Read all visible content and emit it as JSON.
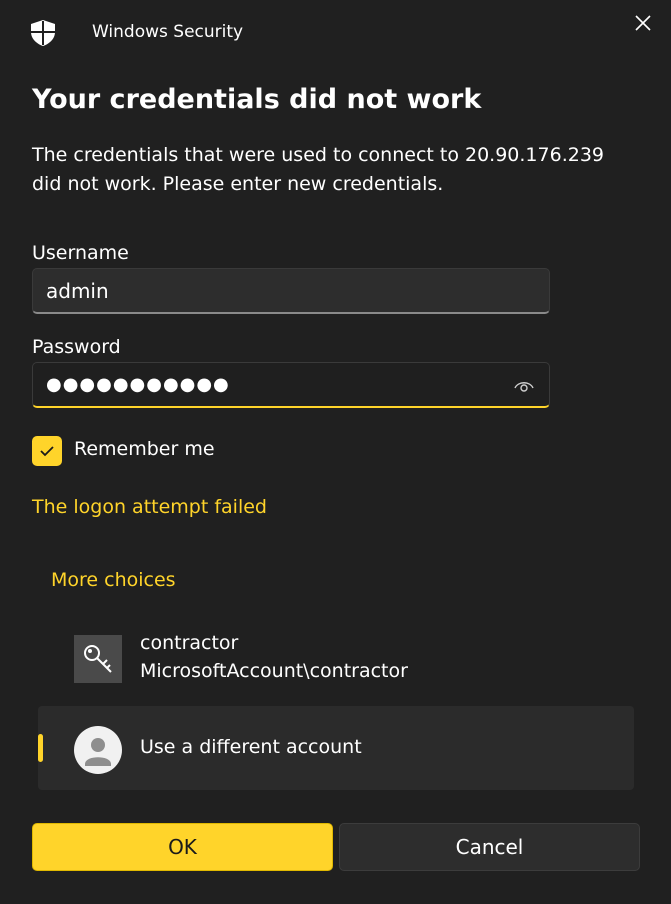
{
  "window": {
    "title": "Windows Security",
    "app_icon": "shield-icon",
    "close_icon": "close-icon"
  },
  "dialog": {
    "heading": "Your credentials did not work",
    "message": "The credentials that were used to connect to 20.90.176.239 did not work. Please enter new credentials."
  },
  "form": {
    "username_label": "Username",
    "username_value": "admin",
    "password_label": "Password",
    "password_masked": "●●●●●●●●●●●",
    "reveal_icon": "eye-icon",
    "remember_label": "Remember me",
    "remember_checked": true
  },
  "error": {
    "text": "The logon attempt failed"
  },
  "choices": {
    "header": "More choices",
    "accounts": [
      {
        "name": "contractor",
        "detail": "MicrosoftAccount\\contractor",
        "icon": "key-icon"
      },
      {
        "name": "Use a different account",
        "icon": "user-avatar-icon",
        "selected": true
      }
    ]
  },
  "buttons": {
    "ok": "OK",
    "cancel": "Cancel"
  },
  "colors": {
    "accent": "#ffd42a",
    "background": "#202020",
    "input_bg": "#2d2d2d"
  }
}
